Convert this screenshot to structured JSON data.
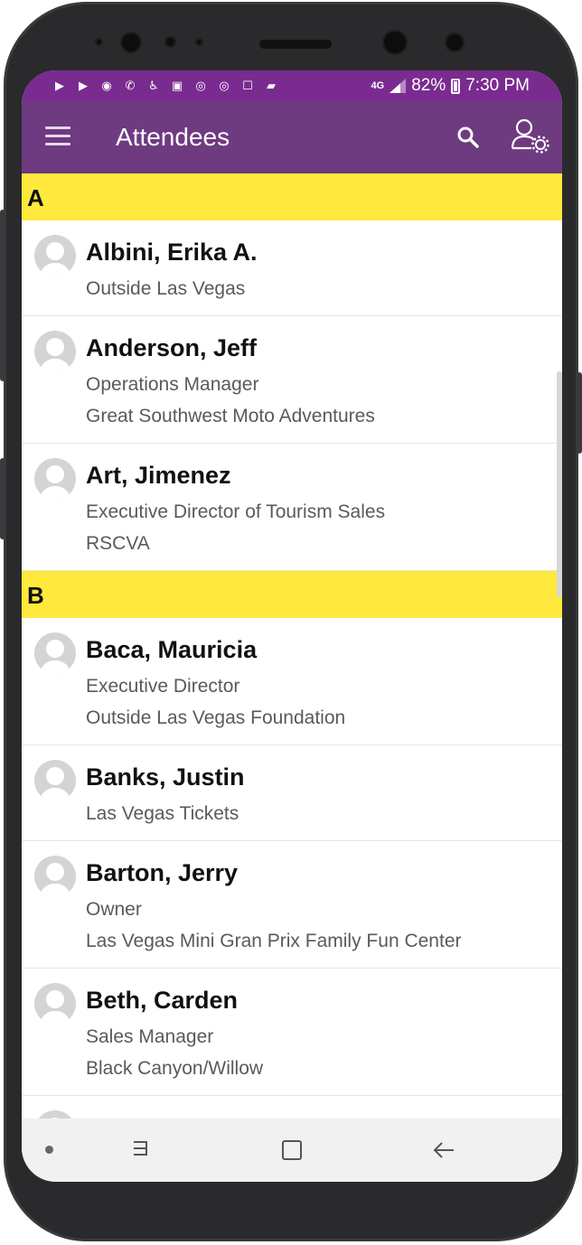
{
  "status_bar": {
    "network": "4G",
    "battery_percent": "82%",
    "time": "7:30 PM",
    "notification_icons": [
      "youtube-icon",
      "youtube-icon",
      "messenger-icon",
      "missed-call-icon",
      "accessibility-icon",
      "image-icon",
      "instagram-icon",
      "instagram-icon",
      "app-icon",
      "message-icon"
    ]
  },
  "app_bar": {
    "title": "Attendees",
    "background": "#6e3a80"
  },
  "sections": [
    {
      "letter": "A",
      "attendees": [
        {
          "name": "Albini, Erika A.",
          "line1": "Outside Las Vegas",
          "line2": ""
        },
        {
          "name": "Anderson, Jeff",
          "line1": "Operations Manager",
          "line2": "Great Southwest Moto Adventures"
        },
        {
          "name": "Art, Jimenez",
          "line1": "Executive Director of Tourism Sales",
          "line2": "RSCVA"
        }
      ]
    },
    {
      "letter": "B",
      "attendees": [
        {
          "name": "Baca, Mauricia",
          "line1": "Executive Director",
          "line2": "Outside Las Vegas Foundation"
        },
        {
          "name": "Banks, Justin",
          "line1": "Las Vegas Tickets",
          "line2": ""
        },
        {
          "name": "Barton, Jerry",
          "line1": "Owner",
          "line2": "Las Vegas Mini Gran Prix Family Fun Center"
        },
        {
          "name": "Beth, Carden",
          "line1": "Sales Manager",
          "line2": "Black Canyon/Willow"
        }
      ]
    }
  ],
  "colors": {
    "section_header": "#ffe93c",
    "status_bar": "#7a2b90"
  }
}
